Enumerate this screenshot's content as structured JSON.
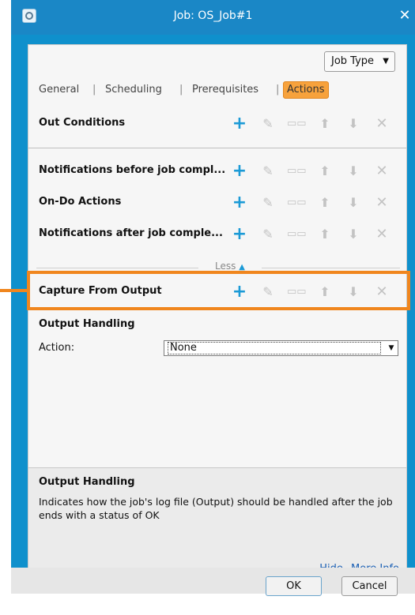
{
  "window": {
    "title": "Job: OS_Job#1"
  },
  "toolbar": {
    "job_type_label": "Job Type"
  },
  "tabs": [
    {
      "label": "General"
    },
    {
      "label": "Scheduling"
    },
    {
      "label": "Prerequisites"
    },
    {
      "label": "Actions",
      "active": true
    }
  ],
  "sections": [
    {
      "label": "Out Conditions"
    },
    {
      "label": "Notifications before job compl..."
    },
    {
      "label": "On-Do Actions"
    },
    {
      "label": "Notifications after job comple..."
    },
    {
      "label": "Capture From Output"
    }
  ],
  "less_toggle": {
    "label": "Less"
  },
  "output_handling": {
    "title": "Output Handling",
    "action_label": "Action:",
    "action_value": "None"
  },
  "help": {
    "title": "Output Handling",
    "description": "Indicates how the job's log file (Output) should be handled after the job ends with a status of OK",
    "hide_link": "Hide",
    "more_link": "More Info"
  },
  "footer": {
    "ok_label": "OK",
    "cancel_label": "Cancel"
  },
  "colors": {
    "title_bar": "#1a87c6",
    "active_tab": "#f7a23c",
    "highlight": "#f0861e",
    "add_icon": "#1b9ad6"
  }
}
